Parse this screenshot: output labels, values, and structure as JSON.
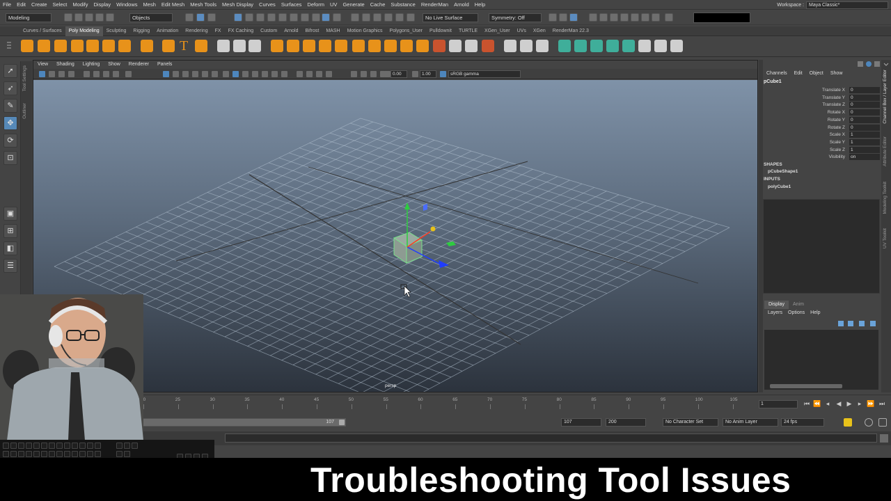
{
  "menubar": {
    "items": [
      "File",
      "Edit",
      "Create",
      "Select",
      "Modify",
      "Display",
      "Windows",
      "Mesh",
      "Edit Mesh",
      "Mesh Tools",
      "Mesh Display",
      "Curves",
      "Surfaces",
      "Deform",
      "UV",
      "Generate",
      "Cache",
      "Substance",
      "RenderMan",
      "Arnold",
      "Help"
    ],
    "workspace_label": "Workspace :",
    "workspace_value": "Maya Classic*"
  },
  "statusline": {
    "mode": "Modeling",
    "select_mode": "Objects",
    "live_surface": "No Live Surface",
    "symmetry": "Symmetry: Off"
  },
  "shelf": {
    "tabs": [
      "Curves / Surfaces",
      "Poly Modeling",
      "Sculpting",
      "Rigging",
      "Animation",
      "Rendering",
      "FX",
      "FX Caching",
      "Custom",
      "Arnold",
      "Bifrost",
      "MASH",
      "Motion Graphics",
      "Polygons_User",
      "Pulldownit",
      "TURTLE",
      "XGen_User",
      "UVs",
      "XGen",
      "RenderMan 22.3"
    ],
    "active_index": 1
  },
  "side_tabs": [
    "Tool Settings",
    "Outliner"
  ],
  "panel": {
    "menus": [
      "View",
      "Shading",
      "Lighting",
      "Show",
      "Renderer",
      "Panels"
    ],
    "near_value": "0.00",
    "far_value": "1.00",
    "color_space": "sRGB gamma",
    "camera": "persp"
  },
  "channel_box": {
    "menus": [
      "Channels",
      "Edit",
      "Object",
      "Show"
    ],
    "object": "pCube1",
    "attributes": [
      {
        "name": "Translate X",
        "value": "0"
      },
      {
        "name": "Translate Y",
        "value": "0"
      },
      {
        "name": "Translate Z",
        "value": "0"
      },
      {
        "name": "Rotate X",
        "value": "0"
      },
      {
        "name": "Rotate Y",
        "value": "0"
      },
      {
        "name": "Rotate Z",
        "value": "0"
      },
      {
        "name": "Scale X",
        "value": "1"
      },
      {
        "name": "Scale Y",
        "value": "1"
      },
      {
        "name": "Scale Z",
        "value": "1"
      },
      {
        "name": "Visibility",
        "value": "on"
      }
    ],
    "shapes_label": "SHAPES",
    "shape_node": "pCubeShape1",
    "inputs_label": "INPUTS",
    "input_node": "polyCube1"
  },
  "vertical_tabs": [
    "Channel Box / Layer Editor",
    "Attribute Editor",
    "Modeling Toolkit",
    "UV Toolkit"
  ],
  "layer_editor": {
    "tabs": [
      "Display",
      "Anim"
    ],
    "menus": [
      "Layers",
      "Options",
      "Help"
    ]
  },
  "time_slider": {
    "ticks": [
      "20",
      "25",
      "30",
      "35",
      "40",
      "45",
      "50",
      "55",
      "60",
      "65",
      "70",
      "75",
      "80",
      "85",
      "90",
      "95",
      "100",
      "105"
    ],
    "current_frame": "1"
  },
  "range_slider": {
    "range_end_inner": "107",
    "end_frame": "107",
    "max_frame": "200",
    "character_set": "No Character Set",
    "anim_layer": "No Anim Layer",
    "fps": "24 fps"
  },
  "banner": {
    "title": "Troubleshooting Tool Issues"
  }
}
